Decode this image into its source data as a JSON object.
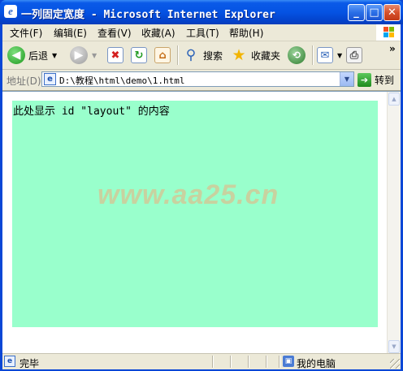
{
  "window": {
    "title": "一列固定宽度 - Microsoft Internet Explorer",
    "app_icon": "ie-icon",
    "buttons": [
      "minimize",
      "maximize",
      "close"
    ]
  },
  "menubar": {
    "items": [
      {
        "label": "文件(F)"
      },
      {
        "label": "编辑(E)"
      },
      {
        "label": "查看(V)"
      },
      {
        "label": "收藏(A)"
      },
      {
        "label": "工具(T)"
      },
      {
        "label": "帮助(H)"
      }
    ]
  },
  "toolbar": {
    "back_label": "后退",
    "search_label": "搜索",
    "favorites_label": "收藏夹",
    "overflow": "»"
  },
  "addressbar": {
    "label": "地址(D)",
    "url": "D:\\教程\\html\\demo\\1.html",
    "go_label": "转到"
  },
  "content": {
    "layout_text": "此处显示 id \"layout\" 的内容",
    "watermark": "www.aa25.cn",
    "layout_bg": "#99ffcc"
  },
  "statusbar": {
    "status": "完毕",
    "zone": "我的电脑"
  },
  "colors": {
    "titlebar": "#0553e3",
    "chrome": "#ece9d8",
    "layout_box": "#99ffcc"
  }
}
